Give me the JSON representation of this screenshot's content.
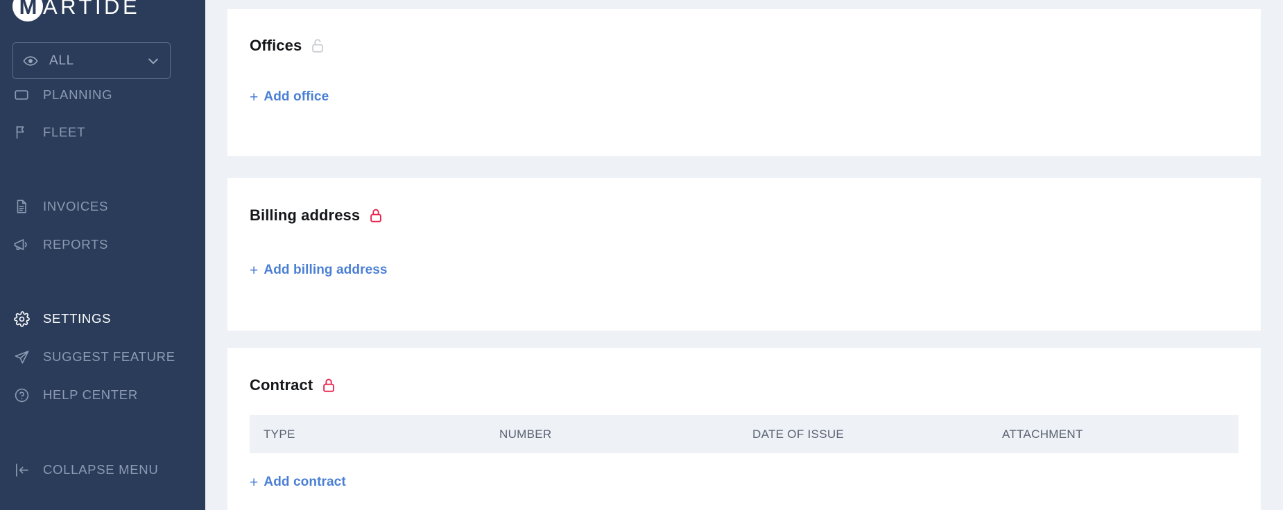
{
  "brand": {
    "name": "MARTIDE",
    "mark_letter": "M",
    "logo_icon": "martide-logo-icon"
  },
  "sidebar": {
    "selector": {
      "label": "ALL",
      "eye_icon": "eye-icon",
      "chevron_icon": "chevron-down-icon"
    },
    "items": [
      {
        "label": "PLANNING",
        "icon": "planning-icon",
        "active": false,
        "clipped": true
      },
      {
        "label": "FLEET",
        "icon": "flag-icon",
        "active": false
      },
      {
        "label": "INVOICES",
        "icon": "document-icon",
        "active": false
      },
      {
        "label": "REPORTS",
        "icon": "megaphone-icon",
        "active": false
      },
      {
        "label": "SETTINGS",
        "icon": "gear-icon",
        "active": true
      },
      {
        "label": "SUGGEST FEATURE",
        "icon": "paper-plane-icon",
        "active": false
      },
      {
        "label": "HELP CENTER",
        "icon": "question-circle-icon",
        "active": false
      },
      {
        "label": "COLLAPSE MENU",
        "icon": "collapse-left-icon",
        "active": false
      }
    ]
  },
  "main": {
    "sections": [
      {
        "title": "Offices",
        "lock_icon": "unlock-icon",
        "lock_state": "unlocked",
        "lock_color": "#c9ccd4",
        "add_label": "Add office",
        "add_plus": "+"
      },
      {
        "title": "Billing address",
        "lock_icon": "lock-icon",
        "lock_state": "locked",
        "lock_color": "#ea1e4a",
        "add_label": "Add billing address",
        "add_plus": "+"
      },
      {
        "title": "Contract",
        "lock_icon": "lock-icon",
        "lock_state": "locked",
        "lock_color": "#ea1e4a",
        "add_label": "Add contract",
        "add_plus": "+",
        "table": {
          "columns": [
            "TYPE",
            "NUMBER",
            "DATE OF ISSUE",
            "ATTACHMENT"
          ],
          "rows": []
        }
      }
    ]
  },
  "colors": {
    "sidebar_bg": "#2b3c5a",
    "page_bg": "#eef1f6",
    "card_bg": "#ffffff",
    "link_blue": "#4a7fd4",
    "lock_red": "#ea1e4a",
    "lock_grey": "#c9ccd4",
    "nav_text": "#8c9ab2",
    "nav_text_active": "#ffffff"
  }
}
